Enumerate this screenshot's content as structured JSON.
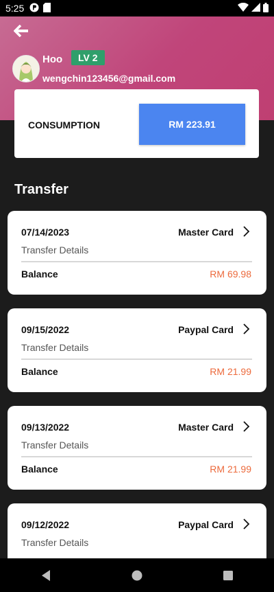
{
  "status_bar": {
    "time": "5:25"
  },
  "user": {
    "name": "Hoo",
    "level": "LV 2",
    "email": "wengchin123456@gmail.com"
  },
  "consumption": {
    "label": "CONSUMPTION",
    "amount": "RM 223.91"
  },
  "section_title": "Transfer",
  "transfers": [
    {
      "date": "07/14/2023",
      "method": "Master Card",
      "details": "Transfer Details",
      "balance_label": "Balance",
      "balance": "RM 69.98"
    },
    {
      "date": "09/15/2022",
      "method": "Paypal Card",
      "details": "Transfer Details",
      "balance_label": "Balance",
      "balance": "RM 21.99"
    },
    {
      "date": "09/13/2022",
      "method": "Master Card",
      "details": "Transfer Details",
      "balance_label": "Balance",
      "balance": "RM 21.99"
    },
    {
      "date": "09/12/2022",
      "method": "Paypal Card",
      "details": "Transfer Details",
      "balance_label": "Balance",
      "balance": ""
    }
  ],
  "colors": {
    "header_accent": "#c0457a",
    "level_badge": "#2f9f6b",
    "consumption_button": "#4b85f0",
    "balance_text": "#ec6a3c"
  }
}
